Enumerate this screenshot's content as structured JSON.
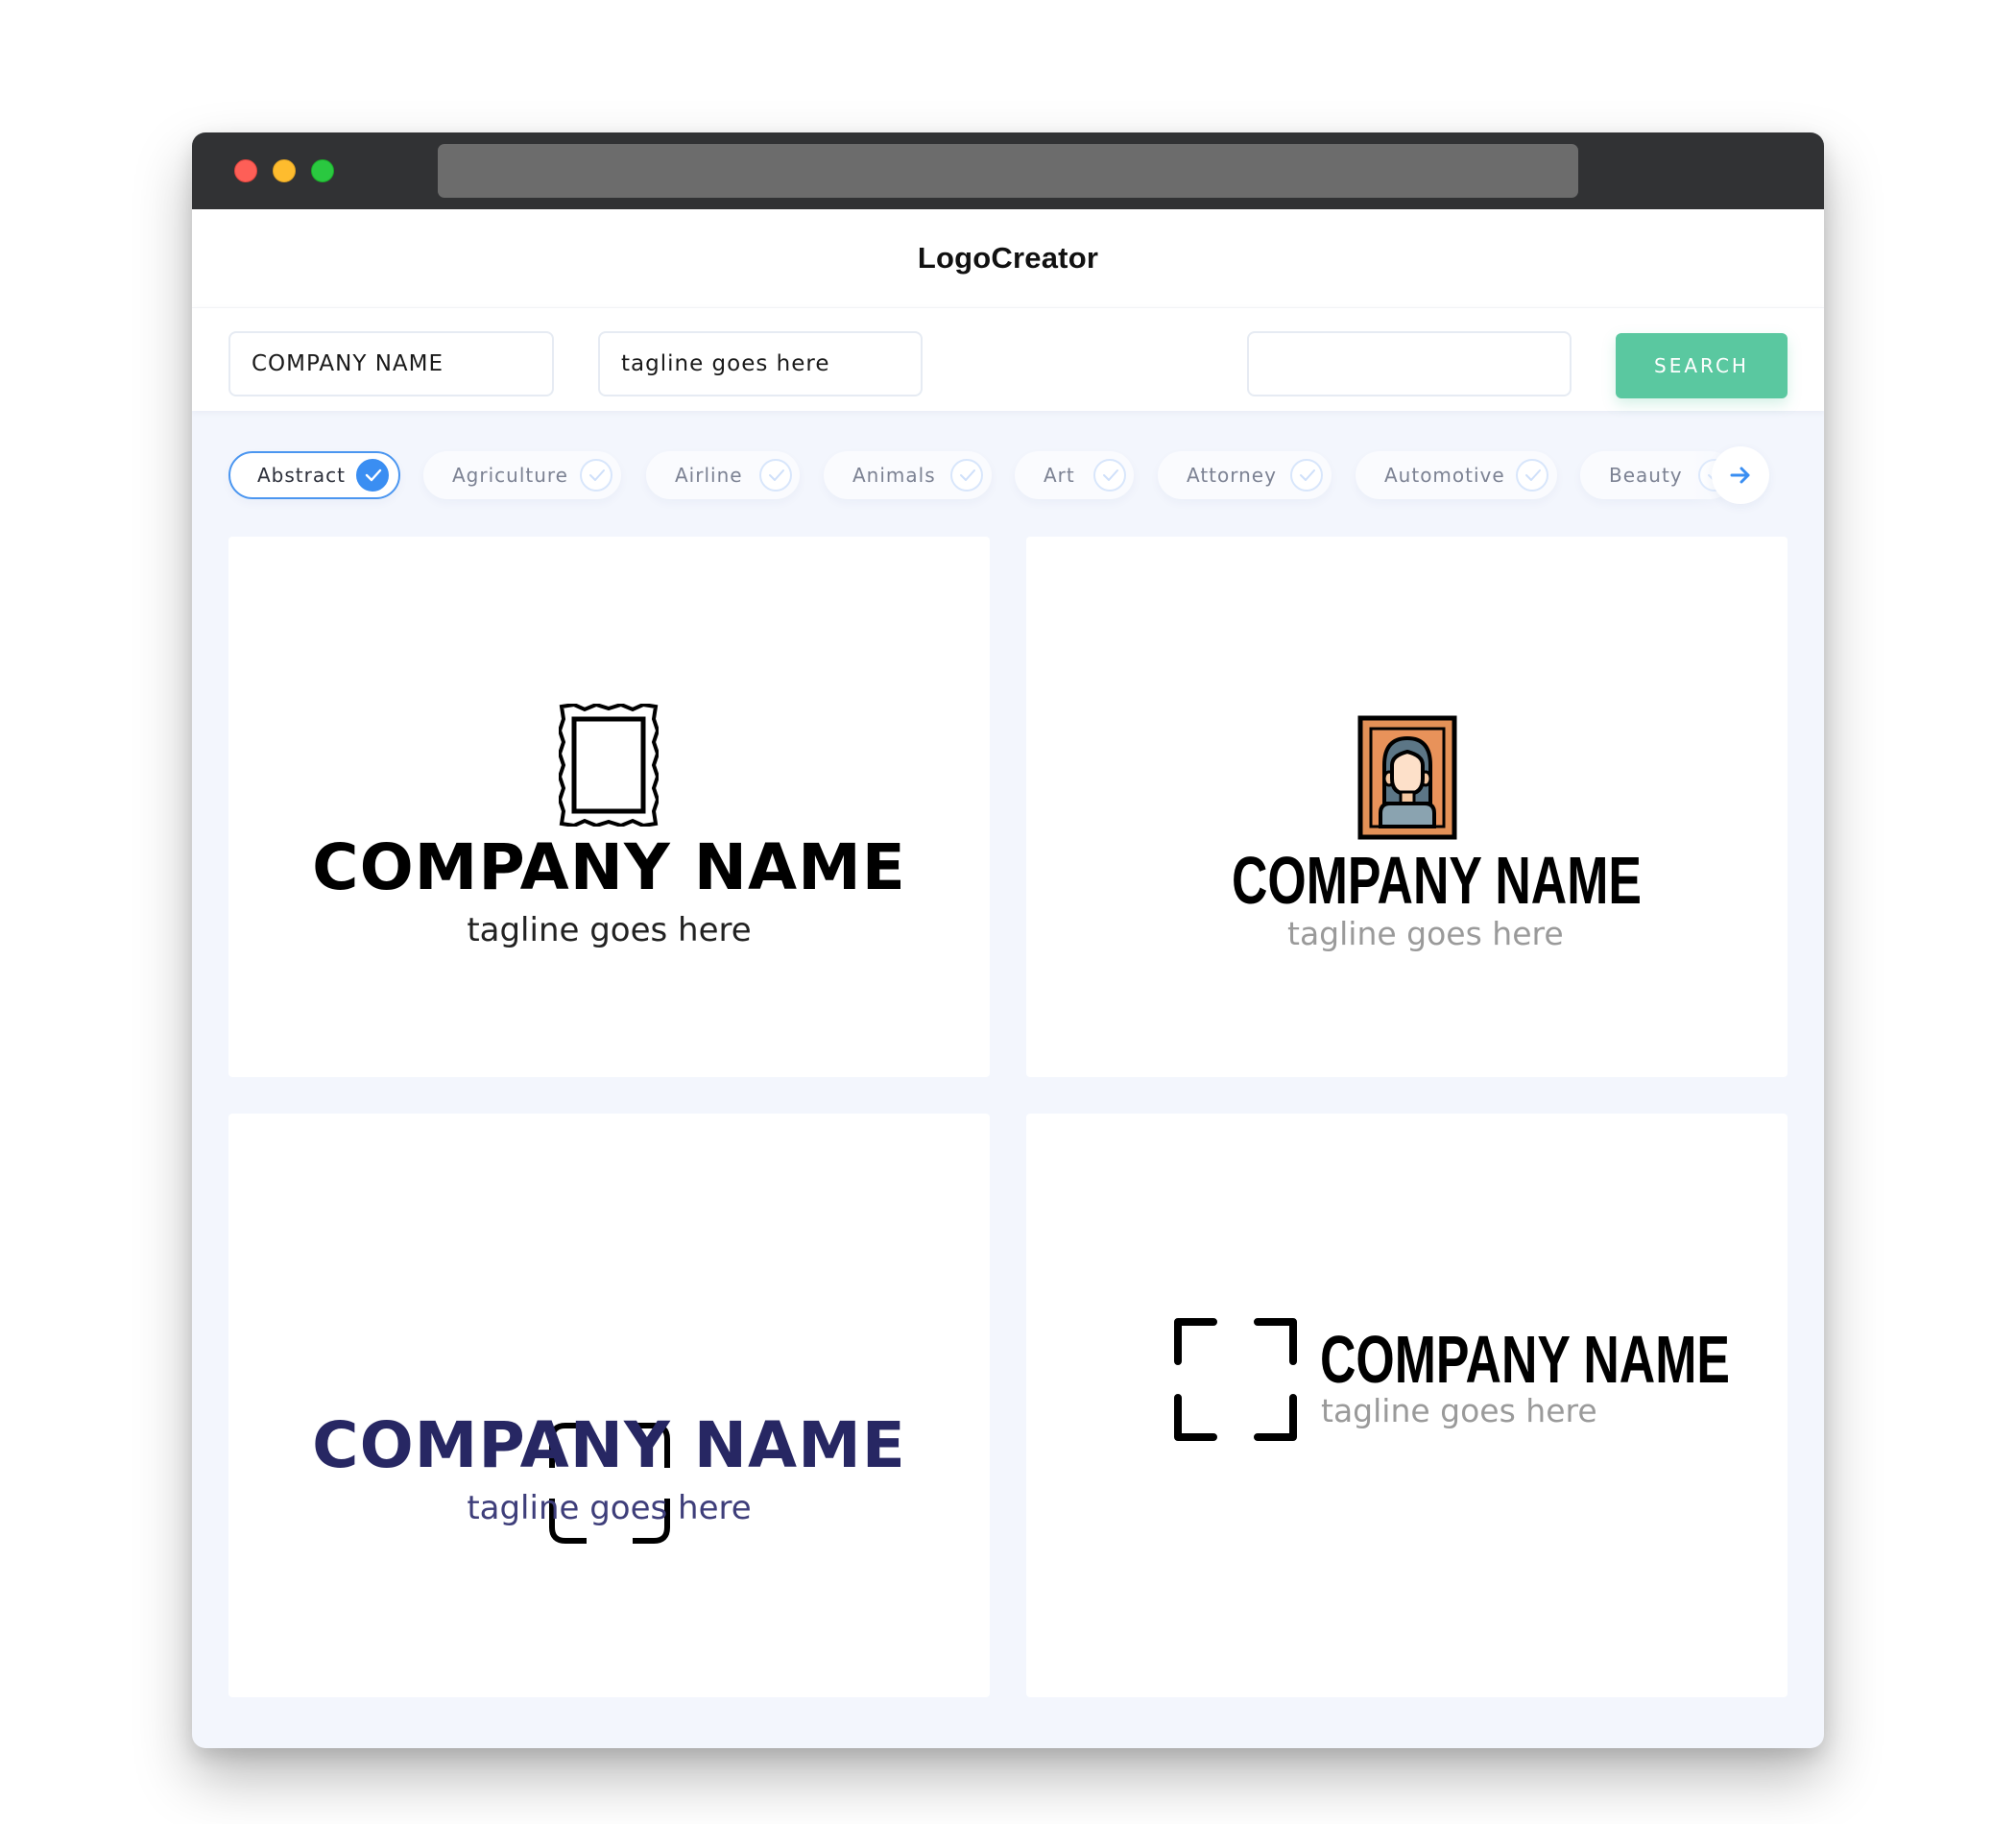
{
  "window": {
    "traffic_lights": [
      "close",
      "minimize",
      "maximize"
    ],
    "url": ""
  },
  "header": {
    "title": "LogoCreator"
  },
  "toolbar": {
    "company_field": {
      "value": "COMPANY NAME",
      "placeholder": ""
    },
    "tagline_field": {
      "value": "tagline goes here",
      "placeholder": ""
    },
    "extra_field": {
      "value": "",
      "placeholder": ""
    },
    "search_label": "SEARCH",
    "search_color": "#5AC8A0"
  },
  "categories": {
    "items": [
      {
        "label": "Abstract",
        "selected": true
      },
      {
        "label": "Agriculture",
        "selected": false
      },
      {
        "label": "Airline",
        "selected": false
      },
      {
        "label": "Animals",
        "selected": false
      },
      {
        "label": "Art",
        "selected": false
      },
      {
        "label": "Attorney",
        "selected": false
      },
      {
        "label": "Automotive",
        "selected": false
      },
      {
        "label": "Beauty",
        "selected": false
      }
    ],
    "next_icon": "arrow-right-icon",
    "accent_color": "#3A8EF2"
  },
  "logos": [
    {
      "icon": "ornate-frame-icon",
      "company": "COMPANY NAME",
      "tagline": "tagline goes here",
      "name_color": "#000000",
      "tagline_color": "#222222"
    },
    {
      "icon": "portrait-frame-icon",
      "company": "COMPANY NAME",
      "tagline": "tagline goes here",
      "name_color": "#000000",
      "tagline_color": "#9A9A9A"
    },
    {
      "icon": "focus-brackets-icon",
      "company": "COMPANY NAME",
      "tagline": "tagline goes here",
      "name_color": "#272763",
      "tagline_color": "#3E3E7A"
    },
    {
      "icon": "focus-brackets-icon",
      "company": "COMPANY NAME",
      "tagline": "tagline goes here",
      "name_color": "#000000",
      "tagline_color": "#9A9A9A"
    }
  ]
}
